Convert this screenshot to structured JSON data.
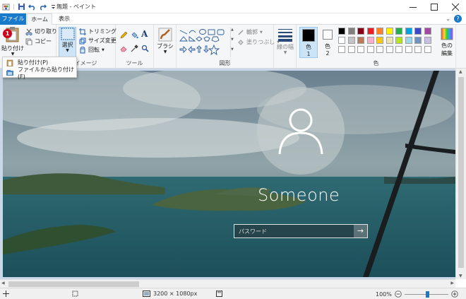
{
  "titlebar": {
    "title": "無題 - ペイント",
    "qat_sep": "|"
  },
  "tabs": {
    "file": "ファイル",
    "home": "ホーム",
    "view": "表示",
    "help": "?"
  },
  "clipboard": {
    "paste": "貼り付け",
    "cut": "切り取り",
    "copy": "コピー"
  },
  "image_group": {
    "label": "イメージ",
    "select": "選択",
    "crop": "トリミング",
    "resize": "サイズ変更",
    "rotate": "回転"
  },
  "tools_group": {
    "label": "ツール"
  },
  "brush": {
    "label": "ブラシ"
  },
  "shapes_group": {
    "label": "図形",
    "outline": "輪郭",
    "fill": "塗りつぶし"
  },
  "size": {
    "label": "線の幅"
  },
  "colors_group": {
    "label": "色",
    "color1": "色",
    "color1_num": "1",
    "color2": "色",
    "color2_num": "2",
    "edit": "色の",
    "edit2": "編集",
    "palette_row1": [
      "#000000",
      "#7f7f7f",
      "#880015",
      "#ed1c24",
      "#ff7f27",
      "#fff200",
      "#22b14c",
      "#00a2e8",
      "#3f48cc",
      "#a349a4"
    ],
    "palette_row2": [
      "#ffffff",
      "#c3c3c3",
      "#b97a57",
      "#ffaec9",
      "#ffc90e",
      "#efe4b0",
      "#b5e61d",
      "#99d9ea",
      "#7092be",
      "#c8bfe7"
    ],
    "palette_row3": [
      "#ffffff",
      "#ffffff",
      "#ffffff",
      "#ffffff",
      "#ffffff",
      "#ffffff",
      "#ffffff",
      "#ffffff",
      "#ffffff",
      "#ffffff"
    ]
  },
  "paste_menu": {
    "item1": "貼り付け(P)",
    "item2": "ファイルから貼り付け(F)"
  },
  "badge": "1",
  "canvas": {
    "login_name": "Someone",
    "password_placeholder": "パスワード",
    "submit_arrow": "→"
  },
  "status": {
    "dimensions": "3200 × 1080px",
    "zoom": "100%"
  }
}
